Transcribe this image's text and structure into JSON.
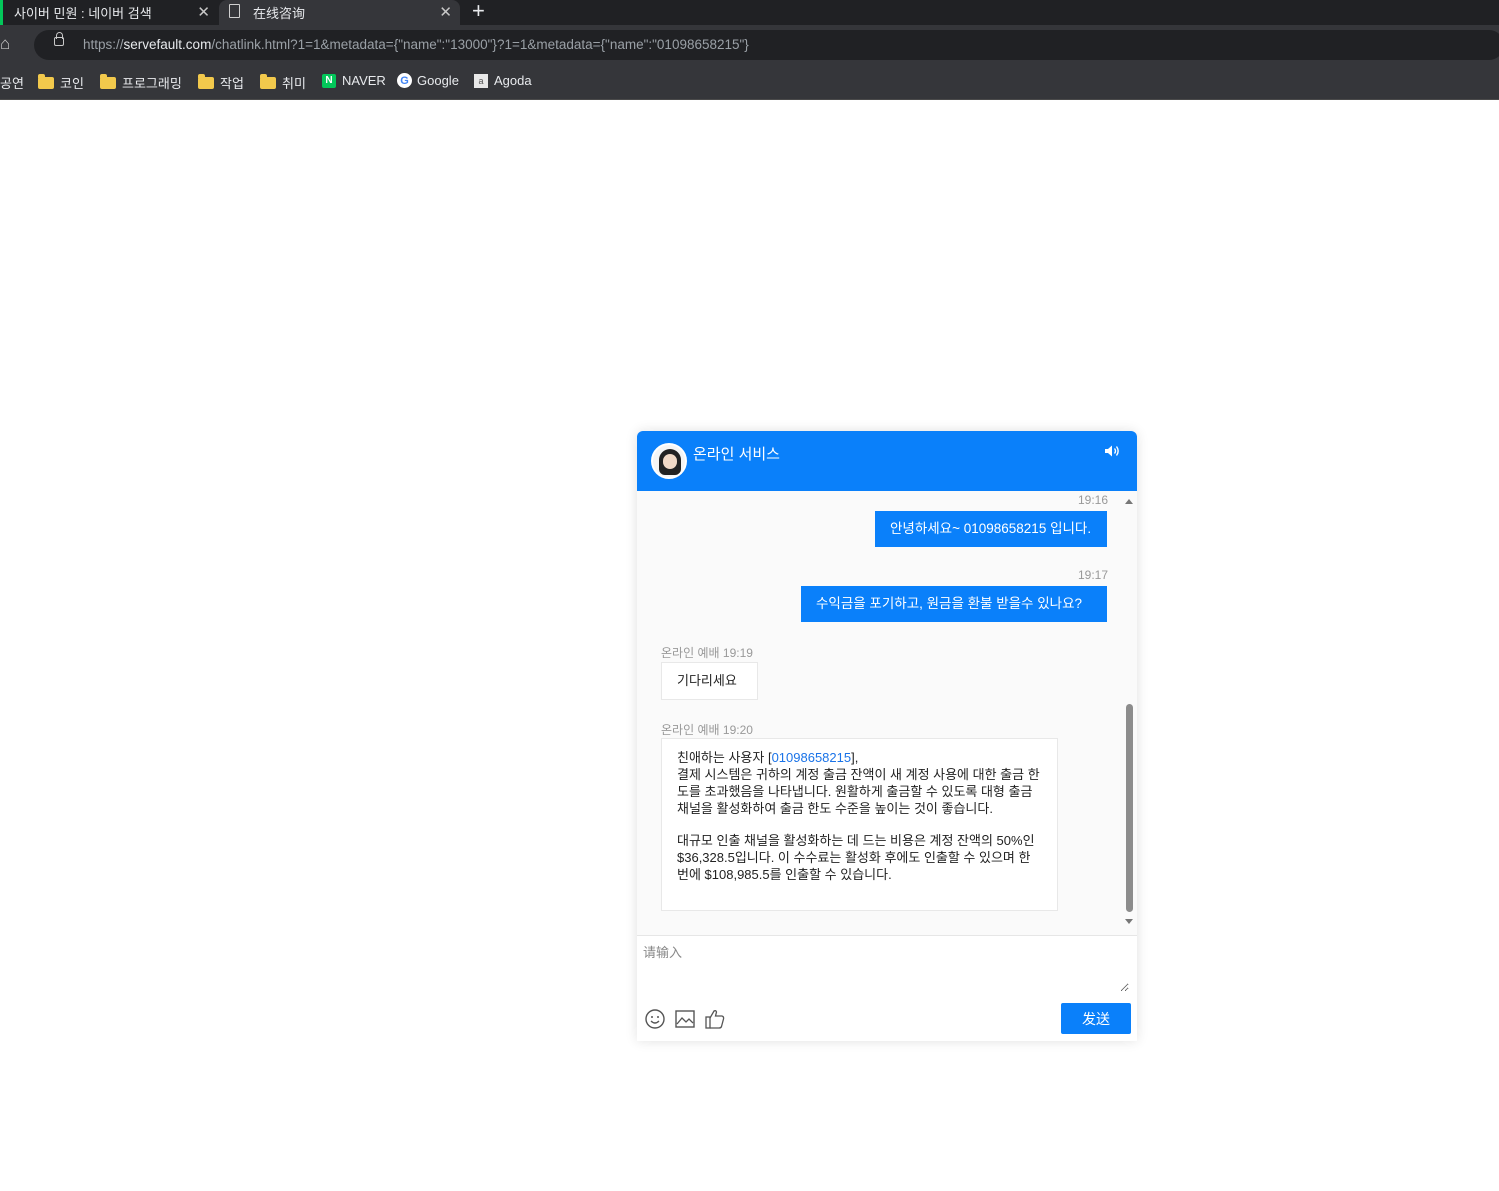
{
  "browser": {
    "tabs": [
      {
        "title": "사이버 민원 : 네이버 검색",
        "active": false
      },
      {
        "title": "在线咨询",
        "active": true
      }
    ],
    "url_prefix": "https://",
    "url_domain": "servefault.com",
    "url_path": "/chatlink.html?1=1&metadata={\"name\":\"13000\"}?1=1&metadata={\"name\":\"01098658215\"}",
    "bookmarks": [
      {
        "label": "공연",
        "icon": "none"
      },
      {
        "label": "코인",
        "icon": "folder-icon"
      },
      {
        "label": "프로그래밍",
        "icon": "folder-icon"
      },
      {
        "label": "작업",
        "icon": "folder-icon"
      },
      {
        "label": "취미",
        "icon": "folder-icon"
      },
      {
        "label": "NAVER",
        "icon": "naver-icon"
      },
      {
        "label": "Google",
        "icon": "google-icon"
      },
      {
        "label": "Agoda",
        "icon": "agoda-icon"
      }
    ]
  },
  "chat": {
    "title": "온라인 서비스",
    "messages": [
      {
        "direction": "out",
        "time": "19:16",
        "text": "안녕하세요~ 01098658215 입니다."
      },
      {
        "direction": "out",
        "time": "19:17",
        "text": "수익금을 포기하고, 원금을 환불 받을수 있나요?"
      },
      {
        "direction": "in",
        "sender": "온라인 예배",
        "time": "19:19",
        "text": "기다리세요"
      },
      {
        "direction": "in",
        "sender": "온라인 예배",
        "time": "19:20",
        "greeting_prefix": "친애하는 사용자 [",
        "user_id": "01098658215",
        "greeting_suffix": "],",
        "paragraph1": "결제 시스템은 귀하의 계정 출금 잔액이 새 계정 사용에 대한 출금 한도를 초과했음을 나타냅니다. 원활하게 출금할 수 있도록 대형 출금 채널을 활성화하여 출금 한도 수준을 높이는 것이 좋습니다.",
        "paragraph2": "대규모 인출 채널을 활성화하는 데 드는 비용은 계정 잔액의 50%인 $36,328.5입니다. 이 수수료는 활성화 후에도 인출할 수 있으며 한 번에 $108,985.5를 인출할 수 있습니다."
      }
    ],
    "input_placeholder": "请输入",
    "send_label": "发送",
    "accent_color": "#0a80fa"
  }
}
